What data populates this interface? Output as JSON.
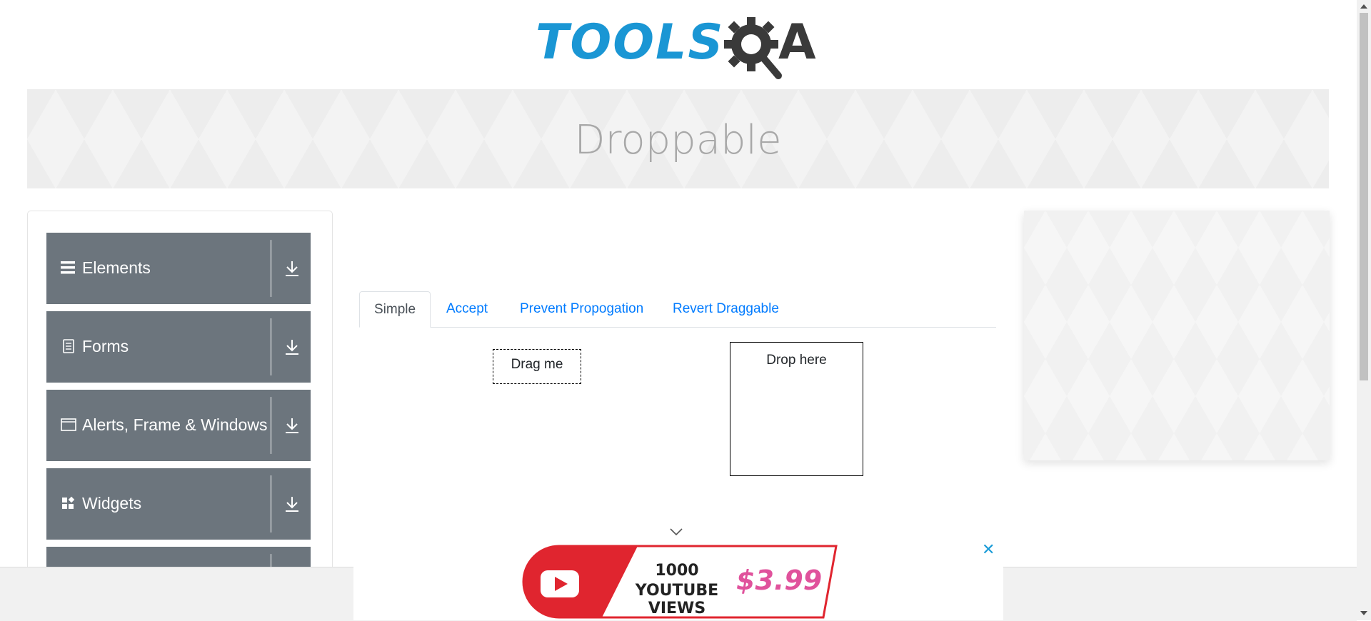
{
  "header": {
    "logo_text": "TOOLS",
    "logo_suffix": "A",
    "logo_alt": "TOOLSQA"
  },
  "banner": {
    "title": "Droppable"
  },
  "sidebar": {
    "groups": [
      {
        "label": "Elements",
        "icon": "hamburger-icon"
      },
      {
        "label": "Forms",
        "icon": "document-icon"
      },
      {
        "label": "Alerts, Frame & Windows",
        "icon": "window-icon"
      },
      {
        "label": "Widgets",
        "icon": "widgets-icon"
      },
      {
        "label": "",
        "icon": ""
      }
    ]
  },
  "tabs": [
    {
      "label": "Simple",
      "active": true
    },
    {
      "label": "Accept",
      "active": false
    },
    {
      "label": "Prevent Propogation",
      "active": false
    },
    {
      "label": "Revert Draggable",
      "active": false
    }
  ],
  "simple": {
    "drag_label": "Drag me",
    "drop_label": "Drop here"
  },
  "ad": {
    "line1": "1000",
    "line2": "YOUTUBE VIEWS",
    "price": "$3.99",
    "close": "✕"
  },
  "colors": {
    "brand_blue": "#1a96d4",
    "sidebar_gray": "#6c757d",
    "link_blue": "#007bff"
  }
}
